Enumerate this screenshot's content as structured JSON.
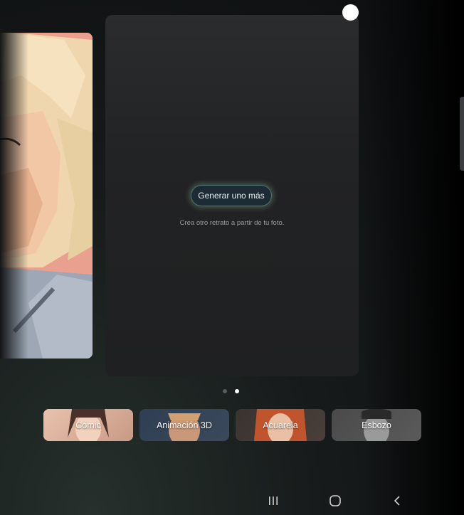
{
  "card": {
    "button_label": "Generar uno más",
    "subtitle": "Crea otro retrato a partir de tu foto."
  },
  "pager": {
    "count": 2,
    "active_index": 1
  },
  "styles": [
    {
      "label": "Cómic",
      "selected": true
    },
    {
      "label": "Animación 3D",
      "selected": false
    },
    {
      "label": "Acuarela",
      "selected": false
    },
    {
      "label": "Esbozo",
      "selected": false
    }
  ],
  "nav": {
    "icons": [
      "recent-apps-icon",
      "home-icon",
      "back-icon"
    ]
  },
  "colors": {
    "card_bg": "#222324",
    "accent_glow": "#8cc8aa",
    "selected_border": "#ffffff"
  }
}
